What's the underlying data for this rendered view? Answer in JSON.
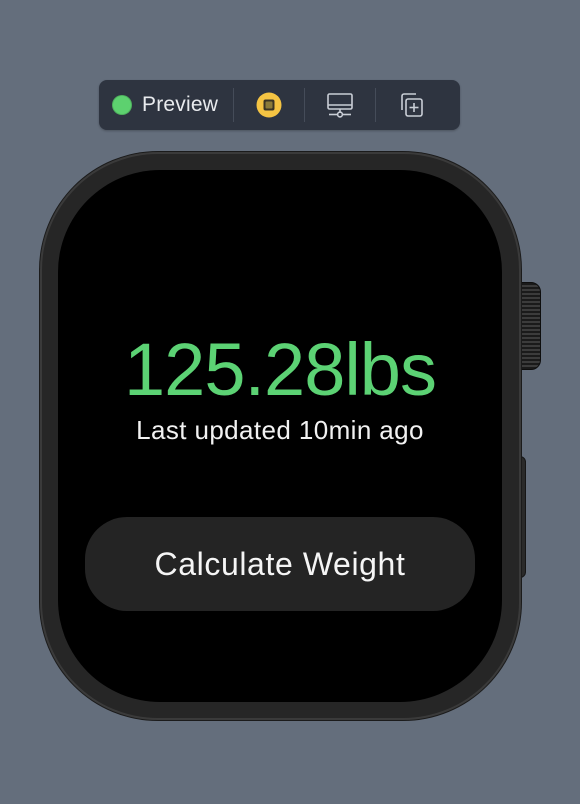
{
  "toolbar": {
    "mode_label": "Preview",
    "items": [
      {
        "icon": "live-preview-dot-icon",
        "color": "#5dd16f"
      },
      {
        "icon": "stop-icon",
        "color": "#f5c443"
      },
      {
        "icon": "device-settings-icon"
      },
      {
        "icon": "duplicate-preview-icon"
      }
    ]
  },
  "watch": {
    "weight_value": "125.28lbs",
    "last_updated": "Last updated 10min ago",
    "calculate_button_label": "Calculate Weight",
    "accent_color": "#5cd274"
  }
}
